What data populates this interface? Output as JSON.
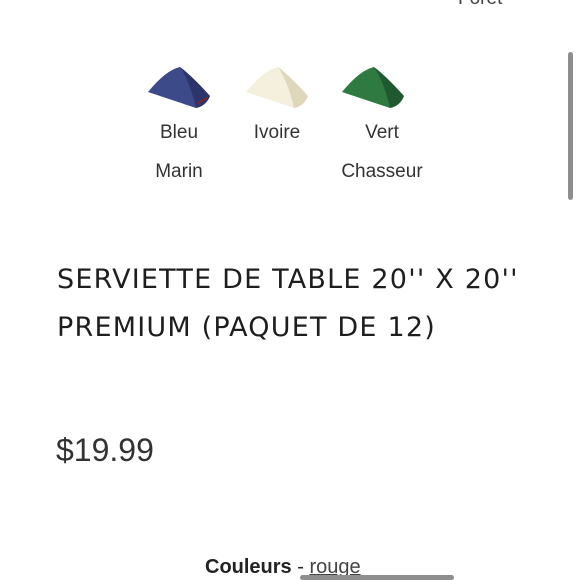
{
  "top_partial_label": "Forêt",
  "swatches": [
    {
      "line1": "Bleu",
      "line2": "Marin",
      "color": "#3d4a8a",
      "shade": "#232c5e",
      "icon": "napkin-icon"
    },
    {
      "line1": "Ivoire",
      "line2": "",
      "color": "#f4f0dd",
      "shade": "#d8d1b4",
      "icon": "napkin-icon"
    },
    {
      "line1": "Vert",
      "line2": "Chasseur",
      "color": "#2f7a40",
      "shade": "#1d4f29",
      "icon": "napkin-icon"
    }
  ],
  "product": {
    "title": "SERVIETTE DE TABLE 20'' X 20'' PREMIUM (PAQUET DE 12)",
    "price": "$19.99"
  },
  "options": {
    "colors_label": "Couleurs",
    "separator": " - ",
    "colors_value": "rouge"
  }
}
